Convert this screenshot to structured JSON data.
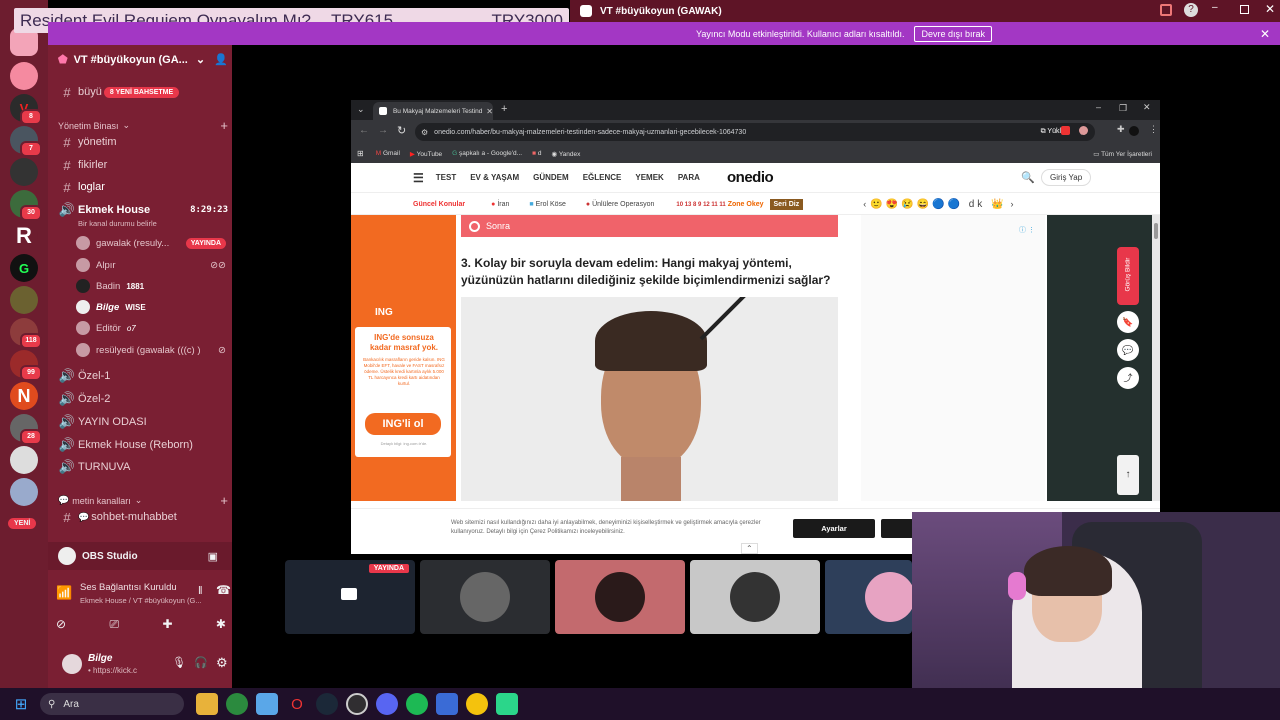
{
  "overlay": {
    "donation_message": "Resident Evil Requiem Oynayalım Mı?",
    "donation_amount_1": "TRY615",
    "donation_amount_2": "TRY3000"
  },
  "window": {
    "title": "VT #büyükoyun (GAWAK)"
  },
  "streamer_notice": {
    "text": "Yayıncı Modu etkinleştirildi. Kullanıcı adları kısaltıldı.",
    "button": "Devre dışı bırak"
  },
  "rail": {
    "badges": [
      "8",
      "7",
      "30",
      "118",
      "99",
      "28"
    ],
    "new_label": "YENİ"
  },
  "sidebar": {
    "server_name": "VT #büyükoyun (GA...",
    "first_channel": "büyü",
    "new_messages_badge": "8 YENİ BAHSETME",
    "category_1": "Yönetim Binası",
    "channels": [
      "yönetim",
      "fikirler",
      "loglar"
    ],
    "voice_channel": "Ekmek House",
    "voice_time": "8:29:23",
    "voice_status": "Bir kanal durumu belirle",
    "voice_users": [
      {
        "name": "gawalak (resuly...",
        "tag": "YAYINDA"
      },
      {
        "name": "Alpır",
        "tag": ""
      },
      {
        "name": "Badin",
        "tag": "1881"
      },
      {
        "name": "Bilge",
        "tag": "WISE"
      },
      {
        "name": "Editör",
        "tag": "o7"
      },
      {
        "name": "resülyedi (gawalak (((c) )",
        "tag": ""
      }
    ],
    "voice_channels": [
      "Özel-1",
      "Özel-2",
      "YAYIN ODASI",
      "Ekmek House (Reborn)",
      "TURNUVA"
    ],
    "category_2": "metin kanalları",
    "text_channels": [
      "sohbet-muhabbet"
    ],
    "obs_label": "OBS Studio",
    "connection_title": "Ses Bağlantısı Kuruldu",
    "connection_sub": "Ekmek House / VT #büyükoyun (G...",
    "user_name": "Bilge",
    "user_status": "• https://kick.c"
  },
  "browser": {
    "tab_title": "Bu Makyaj Malzemeleri Testind",
    "url": "onedio.com/haber/bu-makyaj-malzemeleri-testinden-sadece-makyaj-uzmanlari-gecebilecek-1064730",
    "upload_btn": "Yükle",
    "bookmarks": [
      "Gmail",
      "YouTube",
      "şapkalı a - Google'd...",
      "d",
      "Yandex"
    ],
    "all_bookmarks": "Tüm Yer İşaretleri",
    "nav": [
      "TEST",
      "EV & YAŞAM",
      "GÜNDEM",
      "EĞLENCE",
      "YEMEK",
      "PARA"
    ],
    "logo": "onedio",
    "login": "Giriş Yap",
    "trending_label": "Güncel Konular",
    "trending": [
      "İran",
      "Erol Köse",
      "Ünlülere Operasyon",
      "Zone Okey",
      "Seri Diz"
    ],
    "trend_digits": "10 13 8 9 12 11 11",
    "option_label": "Sonra",
    "question": "3. Kolay bir soruyla devam edelim: Hangi makyaj yöntemi, yüzünüzün hatlarını dilediğiniz şekilde biçimlendirmenizi sağlar?",
    "ad_brand": "ING",
    "ad_headline": "ING'de sonsuza kadar masraf yok.",
    "ad_body": "Bankacılık masrafların geride kalsın. ING Mobil'de EFT, havale ve FAST masrafsız ödeme. Üstelik kredi kartınla aylık 5.000 TL harcayınca kredi kartı aidatından kurtul.",
    "ad_button": "ING'li ol",
    "ad_footer": "Detaylı bilgi: ing.com.tr'de.",
    "feedback": "Görüş Bildir",
    "cookie_text": "Web sitemizi nasıl kullandığınızı daha iyi anlayabilmek, deneyiminizi kişiselleştirmek ve geliştirmek amacıyla çerezler kullanıyoruz. Detaylı bilgi için Çerez Politikamızı inceleyebilirsiniz.",
    "cookie_link": "Çerez Politikamızı",
    "cookie_btn": "Ayarlar"
  },
  "call": {
    "live_tag": "YAYINDA"
  },
  "taskbar": {
    "search": "Ara"
  },
  "colors": {
    "rail": "#6d1d2f",
    "sidebar": "#7a1f33",
    "notice": "#a337c4",
    "live": "#e8374a",
    "onedio_orange": "#f26a21"
  }
}
